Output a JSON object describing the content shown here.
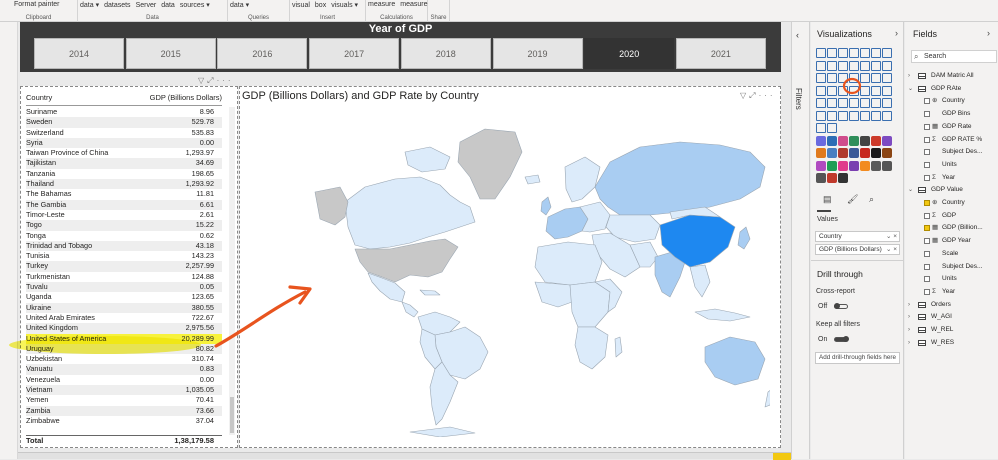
{
  "ribbon": {
    "groups": [
      {
        "label": "Clipboard",
        "items": [
          "Format painter"
        ]
      },
      {
        "label": "Data",
        "items": [
          "data ▾",
          "datasets",
          "Server",
          "data",
          "sources ▾"
        ]
      },
      {
        "label": "Queries",
        "items": [
          "data ▾"
        ]
      },
      {
        "label": "Insert",
        "items": [
          "visual",
          "box",
          "visuals ▾"
        ]
      },
      {
        "label": "Calculations",
        "items": [
          "measure",
          "measure"
        ]
      },
      {
        "label": "Share",
        "items": [
          ""
        ]
      }
    ]
  },
  "slicer": {
    "title": "Year of GDP",
    "years": [
      "2014",
      "2015",
      "2016",
      "2017",
      "2018",
      "2019",
      "2020",
      "2021"
    ],
    "selected": "2020"
  },
  "table": {
    "headers": [
      "Country",
      "GDP (Billions Dollars)"
    ],
    "rows": [
      {
        "country": "Suriname",
        "value": "8.96"
      },
      {
        "country": "Sweden",
        "value": "529.78"
      },
      {
        "country": "Switzerland",
        "value": "535.83"
      },
      {
        "country": "Syria",
        "value": "0.00"
      },
      {
        "country": "Taiwan Province of China",
        "value": "1,293.97"
      },
      {
        "country": "Tajikistan",
        "value": "34.69"
      },
      {
        "country": "Tanzania",
        "value": "198.65"
      },
      {
        "country": "Thailand",
        "value": "1,293.92"
      },
      {
        "country": "The Bahamas",
        "value": "11.81"
      },
      {
        "country": "The Gambia",
        "value": "6.61"
      },
      {
        "country": "Timor-Leste",
        "value": "2.61"
      },
      {
        "country": "Togo",
        "value": "15.22"
      },
      {
        "country": "Tonga",
        "value": "0.62"
      },
      {
        "country": "Trinidad and Tobago",
        "value": "43.18"
      },
      {
        "country": "Tunisia",
        "value": "143.23"
      },
      {
        "country": "Turkey",
        "value": "2,257.99"
      },
      {
        "country": "Turkmenistan",
        "value": "124.88"
      },
      {
        "country": "Tuvalu",
        "value": "0.05"
      },
      {
        "country": "Uganda",
        "value": "123.65"
      },
      {
        "country": "Ukraine",
        "value": "380.55"
      },
      {
        "country": "United Arab Emirates",
        "value": "722.67"
      },
      {
        "country": "United Kingdom",
        "value": "2,975.56"
      },
      {
        "country": "United States of America",
        "value": "20,289.99"
      },
      {
        "country": "Uruguay",
        "value": "80.82"
      },
      {
        "country": "Uzbekistan",
        "value": "310.74"
      },
      {
        "country": "Vanuatu",
        "value": "0.83"
      },
      {
        "country": "Venezuela",
        "value": "0.00"
      },
      {
        "country": "Vietnam",
        "value": "1,035.05"
      },
      {
        "country": "Yemen",
        "value": "70.41"
      },
      {
        "country": "Zambia",
        "value": "73.66"
      },
      {
        "country": "Zimbabwe",
        "value": "37.04"
      }
    ],
    "highlighted_country": "United States of America",
    "total_label": "Total",
    "total_value": "1,38,179.58"
  },
  "map": {
    "title": "GDP (Billions Dollars) and GDP Rate by Country",
    "colors": {
      "light": "#dcebfa",
      "mid": "#a9cdf2",
      "dark": "#1e88f0",
      "nodata": "#c8c8c8",
      "border": "#9aa6b2"
    }
  },
  "annotation": {
    "arrow_color": "#e8541e",
    "highlight_color": "#f7f23c"
  },
  "filters": {
    "label": "Filters"
  },
  "visualizations": {
    "title": "Visualizations",
    "values_label": "Values",
    "wells": [
      "Country",
      "GDP (Billions Dollars)"
    ],
    "drill_title": "Drill through",
    "cross_report_label": "Cross-report",
    "cross_report_state": "Off",
    "keep_filters_label": "Keep all filters",
    "keep_filters_state": "On",
    "drill_add_placeholder": "Add drill-through fields here"
  },
  "fields": {
    "title": "Fields",
    "search_placeholder": "Search",
    "items": [
      {
        "type": "table",
        "name": "DAM Matric All",
        "expanded": false
      },
      {
        "type": "table",
        "name": "GDP RAte",
        "expanded": true
      },
      {
        "type": "field",
        "sym": "⊕",
        "name": "Country",
        "checked": false
      },
      {
        "type": "field",
        "sym": "",
        "name": "GDP Bins",
        "checked": false
      },
      {
        "type": "field",
        "sym": "▦",
        "name": "GDP Rate",
        "checked": false
      },
      {
        "type": "field",
        "sym": "Σ",
        "name": "GDP RATE %",
        "checked": false
      },
      {
        "type": "field",
        "sym": "",
        "name": "Subject Des...",
        "checked": false
      },
      {
        "type": "field",
        "sym": "",
        "name": "Units",
        "checked": false
      },
      {
        "type": "field",
        "sym": "Σ",
        "name": "Year",
        "checked": false
      },
      {
        "type": "table",
        "name": "GDP Value",
        "expanded": true
      },
      {
        "type": "field",
        "sym": "⊕",
        "name": "Country",
        "checked": true
      },
      {
        "type": "field",
        "sym": "Σ",
        "name": "GDP",
        "checked": false
      },
      {
        "type": "field",
        "sym": "▦",
        "name": "GDP (Billion...",
        "checked": true
      },
      {
        "type": "field",
        "sym": "▦",
        "name": "GDP Year",
        "checked": false
      },
      {
        "type": "field",
        "sym": "",
        "name": "Scale",
        "checked": false
      },
      {
        "type": "field",
        "sym": "",
        "name": "Subject Des...",
        "checked": false
      },
      {
        "type": "field",
        "sym": "",
        "name": "Units",
        "checked": false
      },
      {
        "type": "field",
        "sym": "Σ",
        "name": "Year",
        "checked": false
      },
      {
        "type": "table",
        "name": "Orders",
        "expanded": false
      },
      {
        "type": "table",
        "name": "W_AGI",
        "expanded": false
      },
      {
        "type": "table",
        "name": "W_REL",
        "expanded": false
      },
      {
        "type": "table",
        "name": "W_RES",
        "expanded": false
      }
    ]
  }
}
